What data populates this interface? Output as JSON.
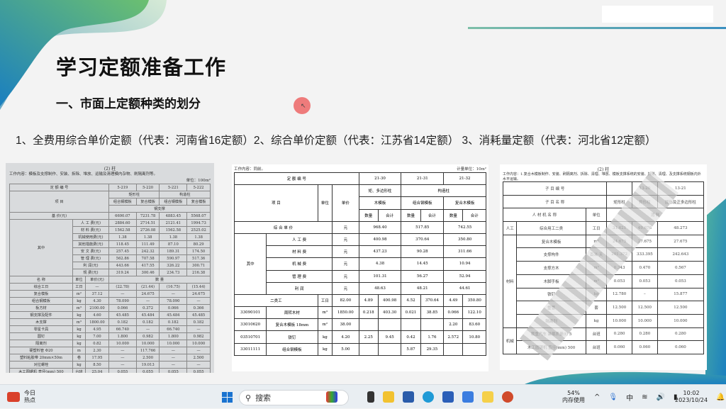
{
  "slide": {
    "title": "学习定额准备工作",
    "subtitle": "一、市面上定额种类的划分",
    "types_line": "1、全费用综合单价定额（代表：河南省16定额）2、综合单价定额（代表：江苏省14定额） 3、消耗量定额（代表：河北省12定额）"
  },
  "doc1": {
    "title": "(2) 柱",
    "work": "工作内容：模板及支撑制作、安装、拆除、堆放、运输及清理模内杂物、刷隔离剂等。",
    "unit": "单位：100m²",
    "rows": [
      [
        {
          "t": "定 额 编 号",
          "cs": 3
        },
        "5-219",
        "5-220",
        "5-221",
        "5-222"
      ],
      [
        {
          "t": "项 目",
          "cs": 3,
          "rs": 3
        },
        {
          "t": "矩形柱",
          "cs": 2
        },
        {
          "t": "构造柱",
          "cs": 2
        }
      ],
      [
        "组合钢模板",
        "复合模板",
        "组合钢模板",
        "复合模板"
      ],
      [
        {
          "t": "钢支撑",
          "cs": 4
        }
      ],
      [
        {
          "t": "基 价(元)",
          "cs": 3
        },
        "6690.07",
        "7231.78",
        "4883.45",
        "5568.07"
      ],
      [
        {
          "t": "其中",
          "rs": 8
        },
        {
          "t": "人 工 费(元)",
          "cs": 2
        },
        "2884.60",
        "2714.51",
        "2121.41",
        "1994.73"
      ],
      [
        {
          "t": "材 料 费(元)",
          "cs": 2
        },
        "1562.58",
        "2726.08",
        "1562.58",
        "2525.02"
      ],
      [
        {
          "t": "机械使用费(元)",
          "cs": 2
        },
        "1.38",
        "1.38",
        "1.38",
        "1.38"
      ],
      [
        {
          "t": "其他措施费(元)",
          "cs": 2
        },
        "118.45",
        "111.49",
        "87.10",
        "80.29"
      ],
      [
        {
          "t": "安 文 费(元)",
          "cs": 2
        },
        "257.45",
        "242.32",
        "189.31",
        "174.50"
      ],
      [
        {
          "t": "管 理 费(元)",
          "cs": 2
        },
        "562.86",
        "707.58",
        "590.97",
        "517.36"
      ],
      [
        {
          "t": "利 润(元)",
          "cs": 2
        },
        "443.66",
        "417.55",
        "326.22",
        "300.71"
      ],
      [
        {
          "t": "规 费(元)",
          "cs": 2
        },
        "319.24",
        "300.46",
        "234.73",
        "216.38"
      ],
      [
        "名 称",
        "单位",
        "单价(元)",
        {
          "t": "数 量",
          "cs": 4
        }
      ],
      [
        "综合工日",
        "工日",
        "—",
        "(22.78)",
        "(21.44)",
        "(16.75)",
        "(15.44)"
      ],
      [
        "复合模板",
        "m²",
        "37.12",
        "—",
        "24.675",
        "—",
        "24.675"
      ],
      [
        "组合钢模板",
        "kg",
        "4.30",
        "78.090",
        "—",
        "78.090",
        "—"
      ],
      [
        "板方材",
        "m³",
        "2100.00",
        "0.066",
        "0.372",
        "0.066",
        "0.366"
      ],
      [
        "钢支撑及配件",
        "kg",
        "4.60",
        "45.485",
        "45.484",
        "45.484",
        "45.485"
      ],
      [
        "木支撑",
        "m³",
        "1800.00",
        "0.182",
        "0.182",
        "0.182",
        "0.182"
      ],
      [
        "零星卡具",
        "kg",
        "4.95",
        "66.740",
        "—",
        "66.740",
        "—"
      ],
      [
        "圆钉",
        "kg",
        "7.00",
        "1.800",
        "0.982",
        "1.800",
        "0.982"
      ],
      [
        "隔离剂",
        "kg",
        "0.82",
        "10.000",
        "10.000",
        "10.000",
        "10.000"
      ],
      [
        "硬塑料管 Φ20",
        "m",
        "2.30",
        "—",
        "117.766",
        "—",
        "—"
      ],
      [
        "塑料粘胶带 20mm×50m",
        "卷",
        "17.95",
        "—",
        "2.500",
        "—",
        "2.500"
      ],
      [
        "对拉螺栓",
        "kg",
        "8.50",
        "—",
        "19.013",
        "—",
        "—"
      ],
      [
        "木工圆锯机 直径(mm) 500",
        "台班",
        "25.04",
        "0.055",
        "0.055",
        "0.055",
        "0.055"
      ]
    ]
  },
  "doc2": {
    "work": "工作内容：同前。",
    "unit": "计量单位：10m²",
    "rows": [
      [
        {
          "t": "定 额 编 号",
          "cs": 4
        },
        {
          "t": "21-30",
          "cs": 2
        },
        {
          "t": "21-31",
          "cs": 2
        },
        {
          "t": "21-32",
          "cs": 2
        }
      ],
      [
        {
          "t": "项 目",
          "cs": 2,
          "rs": 3
        },
        {
          "t": "单位",
          "rs": 3
        },
        {
          "t": "单价",
          "rs": 3
        },
        {
          "t": "矩、多边形柱",
          "cs": 2
        },
        {
          "t": "构造柱",
          "cs": 4
        }
      ],
      [
        {
          "t": "木模板",
          "cs": 2
        },
        {
          "t": "组合钢模板",
          "cs": 2
        },
        {
          "t": "复合木模板",
          "cs": 2
        }
      ],
      [
        "数量",
        "合计",
        "数量",
        "合计",
        "数量",
        "合计"
      ],
      [
        {
          "t": "综 合 单 价",
          "cs": 3
        },
        "元",
        {
          "t": "968.40",
          "cs": 2
        },
        {
          "t": "517.85",
          "cs": 2
        },
        {
          "t": "742.55",
          "cs": 2
        }
      ],
      [
        {
          "t": "其中",
          "rs": 5
        },
        {
          "t": "人 工 费",
          "cs": 2
        },
        "元",
        {
          "t": "400.98",
          "cs": 2
        },
        {
          "t": "370.64",
          "cs": 2
        },
        {
          "t": "350.80",
          "cs": 2
        }
      ],
      [
        {
          "t": "材 料 费",
          "cs": 2
        },
        "元",
        {
          "t": "437.23",
          "cs": 2
        },
        {
          "t": "90.28",
          "cs": 2
        },
        {
          "t": "311.66",
          "cs": 2
        }
      ],
      [
        {
          "t": "机 械 费",
          "cs": 2
        },
        "元",
        {
          "t": "4.38",
          "cs": 2
        },
        {
          "t": "14.45",
          "cs": 2
        },
        {
          "t": "10.94",
          "cs": 2
        }
      ],
      [
        {
          "t": "管 理 费",
          "cs": 2
        },
        "元",
        {
          "t": "101.31",
          "cs": 2
        },
        {
          "t": "56.27",
          "cs": 2
        },
        {
          "t": "52.94",
          "cs": 2
        }
      ],
      [
        {
          "t": "利 润",
          "cs": 2
        },
        "元",
        {
          "t": "48.63",
          "cs": 2
        },
        {
          "t": "48.21",
          "cs": 2
        },
        {
          "t": "44.61",
          "cs": 2
        }
      ],
      [
        {
          "t": "二类工",
          "cs": 2
        },
        "工日",
        "82.00",
        "4.89",
        "400.98",
        "4.52",
        "370.64",
        "4.49",
        "350.80"
      ],
      [
        "33090101",
        "周转木材",
        "m³",
        "1850.00",
        "0.218",
        "403.30",
        "0.021",
        "38.85",
        "0.066",
        "122.10"
      ],
      [
        "33010620",
        "复合木模板 18mm",
        "m²",
        "38.00",
        "",
        "",
        "",
        "",
        "2.20",
        "83.60"
      ],
      [
        "03510701",
        "铁钉",
        "kg",
        "4.20",
        "2.25",
        "9.45",
        "0.42",
        "1.76",
        "2.572",
        "10.80"
      ],
      [
        "33011111",
        "组合钢模板",
        "kg",
        "5.00",
        "",
        "",
        "5.87",
        "29.35",
        "",
        ""
      ]
    ]
  },
  "doc3": {
    "title": "(2) 柱",
    "work": "工作内容：1.复合木模板制作、安装、刷隔离剂、拆除、清理、堆放、模板支撑系统的安装、拆除、清理、及支撑系统钢板内外水平运输。",
    "rows": [
      [
        {
          "t": "子 目 编 号",
          "cs": 3
        },
        "",
        "13-20",
        "13-21"
      ],
      [
        {
          "t": "子 目 名 称",
          "cs": 3
        },
        "矩形柱",
        "异形柱",
        "圆形及正多边形柱"
      ],
      [
        {
          "t": "人 材 机 名 称",
          "cs": 2
        },
        "单位",
        {
          "t": "消 耗",
          "cs": 3
        }
      ],
      [
        "人工",
        "综合用工二类",
        "工日",
        "31.621",
        "49.676",
        "48.273"
      ],
      [
        {
          "t": "材料",
          "rs": 7
        },
        "复合木模板",
        "m²",
        "24.675",
        "27.675",
        "27.675"
      ],
      [
        "支撑构件",
        "百米·天",
        "201.372",
        "333.395",
        "242.643"
      ],
      [
        "支撑方木",
        "m³",
        "0.343",
        "0.470",
        "0.567"
      ],
      [
        "木脚手板",
        "m³",
        "0.053",
        "0.053",
        "0.053"
      ],
      [
        "铁钉",
        "kg",
        "12.780",
        "–",
        "15.877"
      ],
      [
        "塑管",
        "套",
        "12.500",
        "12.500",
        "12.500"
      ],
      [
        "隔离剂",
        "kg",
        "10.000",
        "10.000",
        "10.000"
      ],
      [
        {
          "t": "机械",
          "rs": 2
        },
        "载重汽车 装载质量(t) 5",
        "台班",
        "0.280",
        "0.280",
        "0.280"
      ],
      [
        "木工圆锯机 直径(mm) 500",
        "台班",
        "0.060",
        "0.060",
        "0.060"
      ]
    ]
  },
  "taskbar": {
    "news_line1": "今日",
    "news_line2": "热点",
    "search_placeholder": "搜索",
    "memory_pct": "54%",
    "memory_label": "内存使用",
    "ime": "中",
    "time": "10:02",
    "date": "2023/10/24"
  }
}
